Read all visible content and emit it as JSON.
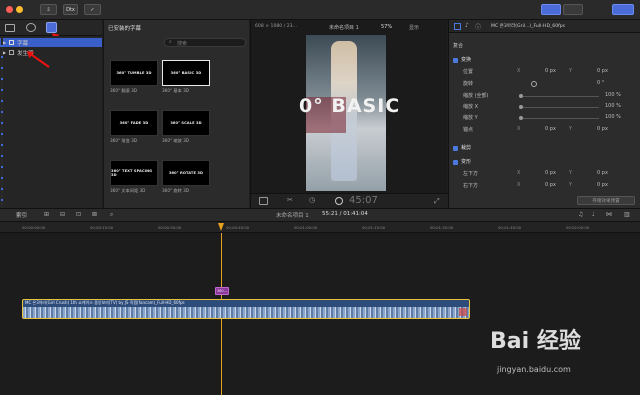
{
  "toolbar": {
    "import_label": "⇩",
    "share_label": "Dtx",
    "check_label": "✓"
  },
  "sidebar": {
    "items": [
      {
        "label": "字幕"
      },
      {
        "label": "发生器"
      }
    ]
  },
  "browser": {
    "title": "已安装的字幕",
    "search_placeholder": "搜索",
    "thumbs": [
      {
        "text": "360° TUMBLE 3D",
        "caption": "360° 翻滚 3D"
      },
      {
        "text": "360° BASIC 3D",
        "caption": "360° 基本 3D"
      },
      {
        "text": "360° FADE 3D",
        "caption": "360° 渐变 3D"
      },
      {
        "text": "360° SCALE 3D",
        "caption": "360° 缩放 3D"
      },
      {
        "text": "360° TEXT SPACING 3D",
        "caption": "360° 文本间距 3D"
      },
      {
        "text": "360° ROTATE 3D",
        "caption": "360° 旋转 3D"
      }
    ]
  },
  "viewer": {
    "format": "608 × 1080 / 23...",
    "project": "未命名项目 1",
    "zoom": "57%",
    "view": "显示",
    "overlay_text": "0° BASIC",
    "timecode": "45:07"
  },
  "inspector": {
    "clip_name": "MC 온3아라(Gril...)_Full-HD_60fps",
    "composite": "复合",
    "transform": "变换",
    "position": "位置",
    "rotation": "旋转",
    "scale_all": "缩放 (全部)",
    "scale_x": "缩放 X",
    "scale_y": "缩放 Y",
    "anchor": "锚点",
    "crop": "裁剪",
    "distort": "变形",
    "bottom_left": "左下方",
    "bottom_right": "右下方",
    "x_label": "X",
    "y_label": "Y",
    "zero_px": "0 px",
    "rotation_value": "0 °",
    "pct_100": "100 %",
    "save_preset": "存储效果预置"
  },
  "timeline_bar": {
    "index_label": "索引",
    "project_name": "未命名项目 1",
    "duration": "55:21 / 01:41:04"
  },
  "ruler": {
    "ticks": [
      "00:00:00:00",
      "00:00:15:00",
      "00:00:30:00",
      "00:00:45:00",
      "00:01:00:00",
      "00:01:15:00",
      "00:01:30:00",
      "00:01:45:00",
      "00:02:00:00"
    ]
  },
  "clip": {
    "title_badge": "360...",
    "clip_name": "MC 온3아라(Girl Crush) 1th 쇼케이스 중앙보라(TV) by JS 직캠(fancam)_Full-HD_60fps"
  },
  "watermark": {
    "brand": "Bai 经验",
    "url": "jingyan.baidu.com"
  },
  "colors": {
    "playhead": "#e6a020",
    "clip_border": "#e7c23a",
    "clip_fill": "#2e4c7a",
    "accent": "#4a7adf",
    "arrow": "#e11111"
  }
}
